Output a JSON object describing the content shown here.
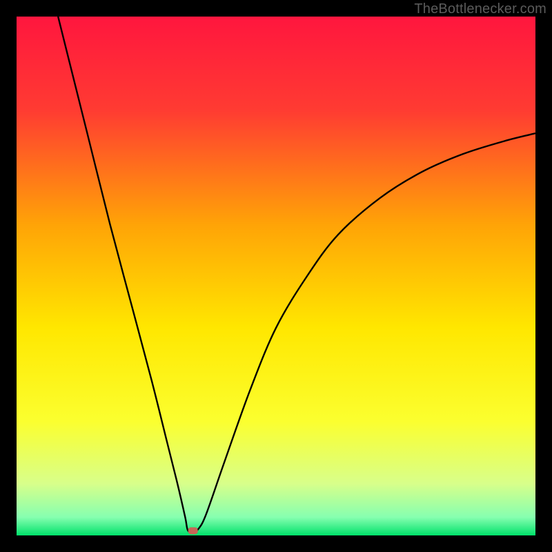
{
  "attribution": "TheBottlenecker.com",
  "chart_data": {
    "type": "line",
    "title": "",
    "xlabel": "",
    "ylabel": "",
    "xlim": [
      0,
      100
    ],
    "ylim": [
      0,
      100
    ],
    "gradient_stops": [
      {
        "offset": 0.0,
        "color": "#ff163e"
      },
      {
        "offset": 0.18,
        "color": "#ff3b32"
      },
      {
        "offset": 0.4,
        "color": "#ffa307"
      },
      {
        "offset": 0.6,
        "color": "#ffe700"
      },
      {
        "offset": 0.78,
        "color": "#fbff2f"
      },
      {
        "offset": 0.9,
        "color": "#d8ff8a"
      },
      {
        "offset": 0.965,
        "color": "#86ffb0"
      },
      {
        "offset": 1.0,
        "color": "#00e16a"
      }
    ],
    "series": [
      {
        "name": "curve",
        "color": "#000000",
        "points": [
          {
            "x": 8.0,
            "y": 100.0
          },
          {
            "x": 10.0,
            "y": 92.0
          },
          {
            "x": 14.0,
            "y": 76.0
          },
          {
            "x": 18.0,
            "y": 60.0
          },
          {
            "x": 22.0,
            "y": 45.0
          },
          {
            "x": 26.0,
            "y": 30.0
          },
          {
            "x": 29.0,
            "y": 18.0
          },
          {
            "x": 31.0,
            "y": 10.0
          },
          {
            "x": 32.5,
            "y": 3.5
          },
          {
            "x": 33.0,
            "y": 1.0
          },
          {
            "x": 34.0,
            "y": 0.6
          },
          {
            "x": 35.0,
            "y": 1.2
          },
          {
            "x": 36.5,
            "y": 4.0
          },
          {
            "x": 40.0,
            "y": 14.0
          },
          {
            "x": 45.0,
            "y": 28.0
          },
          {
            "x": 50.0,
            "y": 40.0
          },
          {
            "x": 56.0,
            "y": 50.0
          },
          {
            "x": 62.0,
            "y": 58.0
          },
          {
            "x": 70.0,
            "y": 65.0
          },
          {
            "x": 78.0,
            "y": 70.0
          },
          {
            "x": 86.0,
            "y": 73.5
          },
          {
            "x": 94.0,
            "y": 76.0
          },
          {
            "x": 100.0,
            "y": 77.5
          }
        ]
      }
    ],
    "marker": {
      "x": 34.0,
      "y": 0.9,
      "color": "#c76657"
    }
  }
}
